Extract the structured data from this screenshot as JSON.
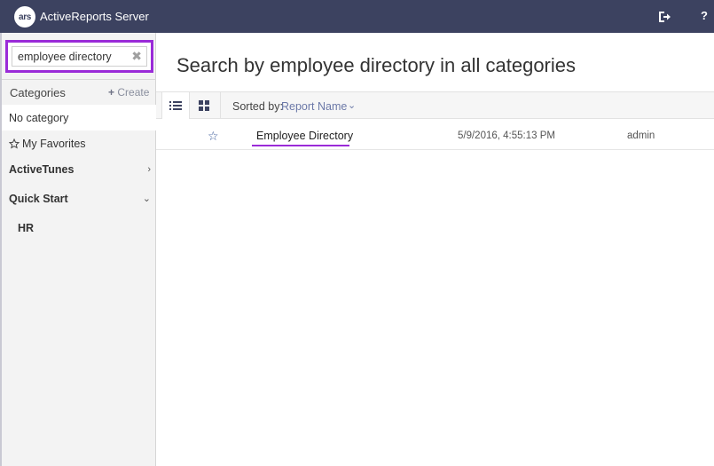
{
  "app": {
    "logo_text": "ars",
    "title": "ActiveReports Server",
    "help_label": "?"
  },
  "search": {
    "value": "employee directory",
    "clear_label": "✖"
  },
  "sidebar": {
    "categories_label": "Categories",
    "create_plus": "+",
    "create_label": "Create",
    "items": [
      {
        "label": "No category"
      },
      {
        "label": "My Favorites",
        "icon": "star-outline-icon"
      },
      {
        "label": "ActiveTunes",
        "chevron": "›"
      },
      {
        "label": "Quick Start",
        "chevron": "⌄"
      },
      {
        "label": "HR"
      }
    ]
  },
  "main": {
    "title": "Search by employee directory in all categories",
    "sort": {
      "label": "Sorted by:",
      "value": "Report Name",
      "chevron": "⌄"
    },
    "results": [
      {
        "name": "Employee Directory",
        "modified": "5/9/2016, 4:55:13 PM",
        "owner": "admin",
        "star": "☆"
      }
    ]
  },
  "colors": {
    "topbar": "#3c4260",
    "highlight": "#9a2bd8",
    "link": "#6c79a8"
  }
}
